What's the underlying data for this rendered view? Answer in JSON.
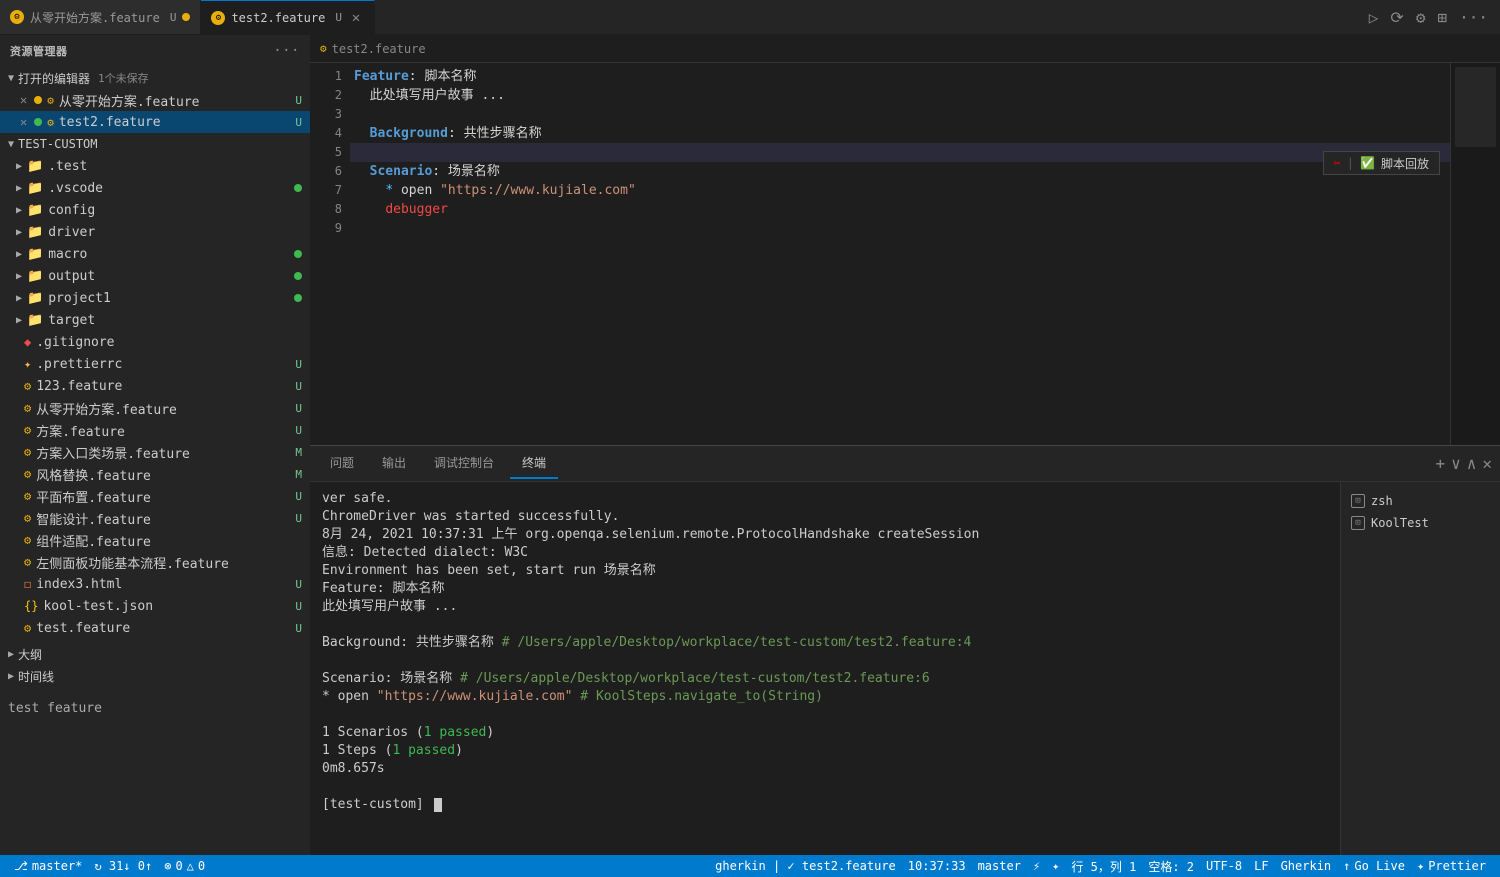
{
  "window": {
    "title": "资源管理器"
  },
  "tabs": [
    {
      "id": "tab1",
      "label": "从零开始方案.feature",
      "icon": "feature-icon",
      "modified": true,
      "active": false,
      "badge": "U"
    },
    {
      "id": "tab2",
      "label": "test2.feature",
      "icon": "feature-icon",
      "modified": false,
      "active": true,
      "badge": "U"
    }
  ],
  "sidebar": {
    "title": "资源管理器",
    "openEditors": {
      "label": "打开的编辑器",
      "count": "1个未保存",
      "items": [
        {
          "name": "从零开始方案.feature",
          "badge": "U",
          "dot": "yellow",
          "close": true
        },
        {
          "name": "test2.feature",
          "badge": "U",
          "dot": "green",
          "close": true
        }
      ]
    },
    "project": {
      "label": "TEST-CUSTOM",
      "folders": [
        {
          "name": ".test",
          "indent": 0
        },
        {
          "name": ".vscode",
          "indent": 0,
          "dot": "green"
        },
        {
          "name": "config",
          "indent": 0
        },
        {
          "name": "driver",
          "indent": 0
        },
        {
          "name": "macro",
          "indent": 0,
          "dot": "green"
        },
        {
          "name": "output",
          "indent": 0,
          "dot": "green"
        },
        {
          "name": "project1",
          "indent": 0,
          "dot": "green"
        },
        {
          "name": "target",
          "indent": 0
        }
      ],
      "files": [
        {
          "name": ".gitignore",
          "icon": "git",
          "badge": ""
        },
        {
          "name": ".prettierrc",
          "icon": "prettier",
          "badge": "U"
        },
        {
          "name": "123.feature",
          "icon": "feature",
          "badge": "U"
        },
        {
          "name": "从零开始方案.feature",
          "icon": "feature",
          "badge": "U"
        },
        {
          "name": "方案.feature",
          "icon": "feature",
          "badge": "U"
        },
        {
          "name": "方案入口类场景.feature",
          "icon": "feature",
          "badge": "M"
        },
        {
          "name": "风格替换.feature",
          "icon": "feature",
          "badge": "M"
        },
        {
          "name": "平面布置.feature",
          "icon": "feature",
          "badge": "U"
        },
        {
          "name": "智能设计.feature",
          "icon": "feature",
          "badge": "U"
        },
        {
          "name": "组件适配.feature",
          "icon": "feature",
          "badge": ""
        },
        {
          "name": "左侧面板功能基本流程.feature",
          "icon": "feature",
          "badge": ""
        },
        {
          "name": "index3.html",
          "icon": "html",
          "badge": "U"
        },
        {
          "name": "kool-test.json",
          "icon": "json",
          "badge": "U"
        },
        {
          "name": "test.feature",
          "icon": "feature",
          "badge": "U"
        }
      ]
    },
    "outline": {
      "label": "大纲"
    },
    "timeline": {
      "label": "时间线"
    }
  },
  "editor": {
    "breadcrumb": "test2.feature",
    "lines": [
      {
        "num": 1,
        "content": "Feature: 脚本名称",
        "type": "feature"
      },
      {
        "num": 2,
        "content": "  此处填写用户故事 ...",
        "type": "normal"
      },
      {
        "num": 3,
        "content": "",
        "type": "empty"
      },
      {
        "num": 4,
        "content": "  Background: 共性步骤名称",
        "type": "background"
      },
      {
        "num": 5,
        "content": "",
        "type": "empty-highlight"
      },
      {
        "num": 6,
        "content": "  Scenario: 场景名称",
        "type": "scenario"
      },
      {
        "num": 7,
        "content": "    * open \"https://www.kujiale.com\"",
        "type": "step"
      },
      {
        "num": 8,
        "content": "    debugger",
        "type": "debugger"
      },
      {
        "num": 9,
        "content": "",
        "type": "empty"
      }
    ],
    "widget": {
      "scissors": "✂",
      "checkmark": "✅",
      "label": "脚本回放"
    }
  },
  "terminal": {
    "tabs": [
      {
        "label": "问题",
        "active": false
      },
      {
        "label": "输出",
        "active": false
      },
      {
        "label": "调试控制台",
        "active": false
      },
      {
        "label": "终端",
        "active": true
      }
    ],
    "sessions": [
      {
        "label": "zsh"
      },
      {
        "label": "KoolTest"
      }
    ],
    "output": [
      {
        "text": "ver safe.",
        "class": "term-white"
      },
      {
        "text": "ChromeDriver was started successfully.",
        "class": "term-white"
      },
      {
        "text": "8月 24, 2021 10:37:31 上午 org.openqa.selenium.remote.ProtocolHandshake createSession",
        "class": "term-white"
      },
      {
        "text": "信息: Detected dialect: W3C",
        "class": "term-white"
      },
      {
        "text": "Environment has been set, start run 场景名称",
        "class": "term-white"
      },
      {
        "text": "Feature: 脚本名称",
        "class": "term-white"
      },
      {
        "text": "  此处填写用户故事 ...",
        "class": "term-white"
      },
      {
        "text": "",
        "class": ""
      },
      {
        "text": "  Background: 共性步骤名称  # /Users/apple/Desktop/workplace/test-custom/test2.feature:4",
        "class": "term-white",
        "comment": "# /Users/apple/Desktop/workplace/test-custom/test2.feature:4"
      },
      {
        "text": "",
        "class": ""
      },
      {
        "text": "  Scenario: 场景名称                         # /Users/apple/Desktop/workplace/test-custom/test2.feature:6",
        "class": "term-white"
      },
      {
        "text": "    * open \"https://www.kujiale.com\"  # KoolSteps.navigate_to(String)",
        "class": "term-step"
      },
      {
        "text": "",
        "class": ""
      },
      {
        "text": "1 Scenarios (1 passed)",
        "class": "term-white"
      },
      {
        "text": "1 Steps (1 passed)",
        "class": "term-white"
      },
      {
        "text": "0m8.657s",
        "class": "term-white"
      },
      {
        "text": "",
        "class": ""
      },
      {
        "text": "[test-custom] ",
        "class": "term-prompt",
        "cursor": true
      }
    ]
  },
  "statusBar": {
    "left": [
      {
        "icon": "branch-icon",
        "text": "master*"
      },
      {
        "icon": "sync-icon",
        "text": "↻ 31↓ 0↑"
      },
      {
        "icon": "error-icon",
        "text": "⊗ 0 △ 0"
      }
    ],
    "right": [
      {
        "text": "行 5，列 1"
      },
      {
        "text": "空格: 2"
      },
      {
        "text": "UTF-8"
      },
      {
        "text": "LF"
      },
      {
        "text": "Gherkin"
      },
      {
        "text": "↑ Go Live"
      },
      {
        "text": "✦ Prettier"
      }
    ],
    "gherkin": "gherkin | ✓ test2.feature",
    "time": "10:37:33",
    "branch": "master"
  },
  "test_feature_label": "test feature"
}
